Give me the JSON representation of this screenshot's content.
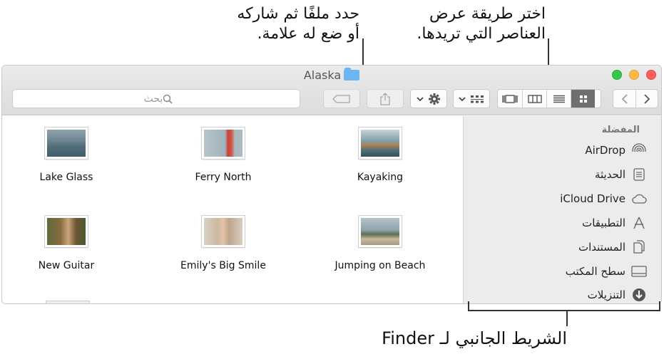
{
  "callouts": {
    "share_tag": [
      "حدد ملفًا ثم شاركه",
      "أو ضع له علامة."
    ],
    "view_mode": [
      "اختر طريقة عرض",
      "العناصر التي تريدها."
    ],
    "sidebar": "الشريط الجانبي لـ Finder"
  },
  "window": {
    "title": "Alaska",
    "search_placeholder": "بحث"
  },
  "sidebar": {
    "header": "المفضلة",
    "items": [
      {
        "label": "AirDrop",
        "icon": "airdrop-icon"
      },
      {
        "label": "الحديثة",
        "icon": "recents-icon"
      },
      {
        "label": "iCloud Drive",
        "icon": "cloud-icon"
      },
      {
        "label": "التطبيقات",
        "icon": "applications-icon"
      },
      {
        "label": "المستندات",
        "icon": "documents-icon"
      },
      {
        "label": "سطح المكتب",
        "icon": "desktop-icon"
      },
      {
        "label": "التنزيلات",
        "icon": "downloads-icon"
      }
    ]
  },
  "files": [
    {
      "name": "Lake Glass"
    },
    {
      "name": "Ferry North"
    },
    {
      "name": "Kayaking"
    },
    {
      "name": "New Guitar"
    },
    {
      "name": "Emily's Big Smile"
    },
    {
      "name": "Jumping on Beach"
    }
  ],
  "colors": {
    "close": "#fc605c",
    "minimize": "#fdbc40",
    "zoom": "#34c84a",
    "active_view": "#6f6f6f",
    "folder": "#6cb6f4"
  }
}
